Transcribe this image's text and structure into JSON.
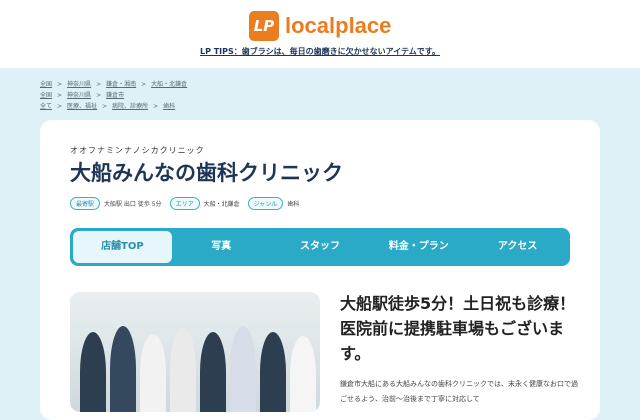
{
  "header": {
    "logo_mark": "LP",
    "logo_text": "localplace",
    "tips": "LP TIPS：歯ブラシは、毎日の歯磨きに欠かせないアイテムです。"
  },
  "breadcrumbs": [
    [
      "全国",
      "神奈川県",
      "鎌倉・湘南",
      "大船・北鎌倉"
    ],
    [
      "全国",
      "神奈川県",
      "鎌倉市"
    ],
    [
      "全て",
      "医療、福祉",
      "病院、診療所",
      "歯科"
    ]
  ],
  "separator": ">",
  "clinic": {
    "kana": "オオフナミンナノシカクリニック",
    "name": "大船みんなの歯科クリニック",
    "tags": [
      {
        "label": "最寄駅",
        "value": "大船駅 出口 徒歩 5分"
      },
      {
        "label": "エリア",
        "value": "大船・北鎌倉"
      },
      {
        "label": "ジャンル",
        "value": "歯科"
      }
    ]
  },
  "tabs": [
    "店舗TOP",
    "写真",
    "スタッフ",
    "料金・プラン",
    "アクセス"
  ],
  "headline": "大船駅徒歩5分！土日祝も診療！医院前に提携駐車場もございます。",
  "description": "鎌倉市大船にある大船みんなの歯科クリニックでは、末永く健康なお口で過ごせるよう、治前〜治後まで丁寧に対応して",
  "colors": {
    "brand": "#ea7d1f",
    "accent": "#2aaac6",
    "title": "#1d3557"
  }
}
